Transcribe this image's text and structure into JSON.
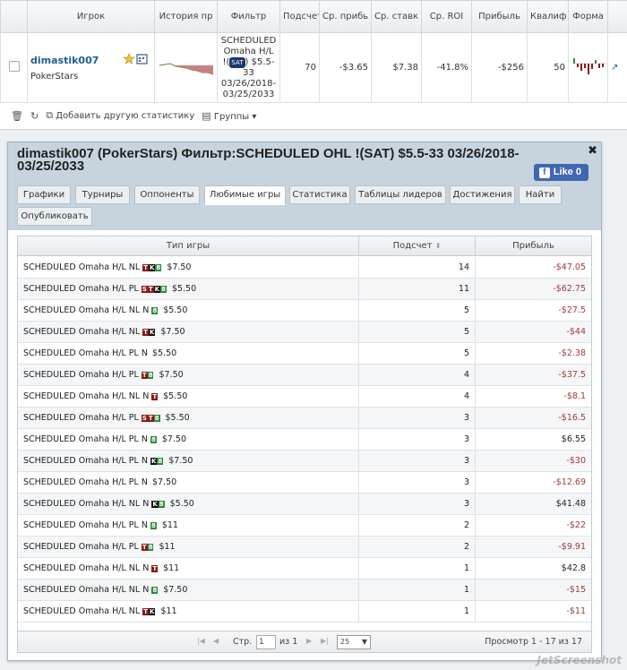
{
  "stats": {
    "headers": [
      "",
      "Игрок",
      "История пр",
      "Фильтр",
      "Подсчет",
      "Ср. прибь",
      "Ср. ставк",
      "Ср. ROI",
      "Прибыль",
      "Квалиф",
      "Форма"
    ],
    "player": "dimastik007",
    "site": "PokerStars",
    "filter_lines": [
      "SCHEDULED",
      "Omaha H/L",
      "!(SAT) $5.5-",
      "33",
      "03/26/2018-",
      "03/25/2033"
    ],
    "sat_badge": "SAT",
    "count": "70",
    "avg_profit": "-$3.65",
    "avg_stake": "$7.38",
    "avg_roi": "-41.8%",
    "profit": "-$256",
    "qualif": "50",
    "toolbar": {
      "add_stats": "Добавить другую статистику",
      "groups": "Группы"
    }
  },
  "dialog": {
    "title": "dimastik007 (PokerStars) Фильтр:SCHEDULED OHL !(SAT) $5.5-33 03/26/2018-03/25/2033",
    "like_label": "Like",
    "like_count": "0",
    "tabs": [
      "Графики",
      "Турниры",
      "Оппоненты",
      "Любимые игры",
      "Статистика",
      "Таблицы лидеров",
      "Достижения",
      "Найти",
      "Опубликовать"
    ],
    "active_tab": "Любимые игры",
    "columns": [
      "Тип игры",
      "Подсчет",
      "Прибыль"
    ],
    "rows": [
      {
        "game": "SCHEDULED Omaha H/L NL",
        "tags": [
          "T",
          "K",
          "8"
        ],
        "stake": "$7.50",
        "count": "14",
        "profit": "-$47.05"
      },
      {
        "game": "SCHEDULED Omaha H/L PL",
        "tags": [
          "S",
          "T",
          "K",
          "8"
        ],
        "stake": "$5.50",
        "count": "11",
        "profit": "-$62.75"
      },
      {
        "game": "SCHEDULED Omaha H/L NL N",
        "tags": [
          "8"
        ],
        "stake": "$5.50",
        "count": "5",
        "profit": "-$27.5"
      },
      {
        "game": "SCHEDULED Omaha H/L NL",
        "tags": [
          "T",
          "K"
        ],
        "stake": "$7.50",
        "count": "5",
        "profit": "-$44"
      },
      {
        "game": "SCHEDULED Omaha H/L PL N",
        "tags": [],
        "stake": "$5.50",
        "count": "5",
        "profit": "-$2.38"
      },
      {
        "game": "SCHEDULED Omaha H/L PL",
        "tags": [
          "T",
          "8"
        ],
        "stake": "$7.50",
        "count": "4",
        "profit": "-$37.5"
      },
      {
        "game": "SCHEDULED Omaha H/L NL N",
        "tags": [
          "T"
        ],
        "stake": "$5.50",
        "count": "4",
        "profit": "-$8.1"
      },
      {
        "game": "SCHEDULED Omaha H/L PL",
        "tags": [
          "S",
          "T",
          "8"
        ],
        "stake": "$5.50",
        "count": "3",
        "profit": "-$16.5"
      },
      {
        "game": "SCHEDULED Omaha H/L PL N",
        "tags": [
          "8"
        ],
        "stake": "$7.50",
        "count": "3",
        "profit": "$6.55"
      },
      {
        "game": "SCHEDULED Omaha H/L PL N",
        "tags": [
          "K",
          "8"
        ],
        "stake": "$7.50",
        "count": "3",
        "profit": "-$30"
      },
      {
        "game": "SCHEDULED Omaha H/L PL N",
        "tags": [],
        "stake": "$7.50",
        "count": "3",
        "profit": "-$12.69"
      },
      {
        "game": "SCHEDULED Omaha H/L NL N",
        "tags": [
          "K",
          "8"
        ],
        "stake": "$5.50",
        "count": "3",
        "profit": "$41.48"
      },
      {
        "game": "SCHEDULED Omaha H/L PL N",
        "tags": [
          "8"
        ],
        "stake": "$11",
        "count": "2",
        "profit": "-$22"
      },
      {
        "game": "SCHEDULED Omaha H/L PL",
        "tags": [
          "T",
          "8"
        ],
        "stake": "$11",
        "count": "2",
        "profit": "-$9.91"
      },
      {
        "game": "SCHEDULED Omaha H/L NL N",
        "tags": [
          "T"
        ],
        "stake": "$11",
        "count": "1",
        "profit": "$42.8"
      },
      {
        "game": "SCHEDULED Omaha H/L NL N",
        "tags": [
          "8"
        ],
        "stake": "$7.50",
        "count": "1",
        "profit": "-$15"
      },
      {
        "game": "SCHEDULED Omaha H/L NL",
        "tags": [
          "T",
          "K"
        ],
        "stake": "$11",
        "count": "1",
        "profit": "-$11"
      }
    ],
    "pager": {
      "page_label": "Стр.",
      "page_value": "1",
      "of_label": "из 1",
      "per_page": "25",
      "view_label": "Просмотр 1 - 17 из 17"
    }
  },
  "watermark": "JetScreenshot",
  "colors": {
    "negative": "#a03c3c",
    "header_bg": "#c7d4dd",
    "like_blue": "#4267b2"
  }
}
